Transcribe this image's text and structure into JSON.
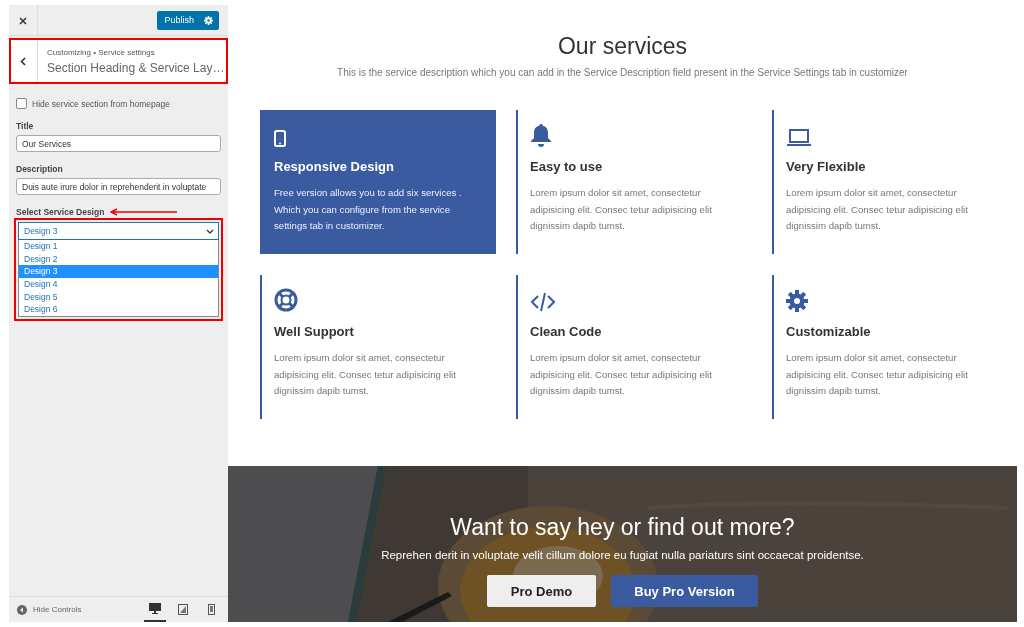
{
  "customizer": {
    "publish_button": "Publish",
    "breadcrumb": "Customizing • Service settings",
    "section_title": "Section Heading & Service Lay…",
    "hide_section": {
      "label": "Hide service section from homepage",
      "checked": false
    },
    "title_field": {
      "label": "Title",
      "value": "Our Services"
    },
    "description_field": {
      "label": "Description",
      "value": "Duis aute irure dolor in reprehenderit in voluptate"
    },
    "design_select": {
      "label": "Select Service Design",
      "value": "Design 3",
      "expanded": true,
      "options": [
        {
          "label": "Design 1",
          "selected": false
        },
        {
          "label": "Design 2",
          "selected": false
        },
        {
          "label": "Design 3",
          "selected": true
        },
        {
          "label": "Design 4",
          "selected": false
        },
        {
          "label": "Design 5",
          "selected": false
        },
        {
          "label": "Design 6",
          "selected": false
        }
      ]
    },
    "hide_controls": "Hide Controls",
    "devices": [
      {
        "kind": "desktop",
        "selected": true
      },
      {
        "kind": "tablet",
        "selected": false
      },
      {
        "kind": "mobile",
        "selected": false
      }
    ]
  },
  "services": {
    "heading": "Our services",
    "description": "This is the service description which you can add in the Service Description field present in the Service Settings tab in customizer",
    "items": [
      {
        "kind": "phone",
        "title": "Responsive Design",
        "text": "Free version allows you to add six services . Which you can configure from the service settings tab in customizer.",
        "highlighted": true
      },
      {
        "kind": "bell",
        "title": "Easy to use",
        "text": "Lorem ipsum dolor sit amet, consectetur adipisicing elit. Consec tetur adipisicing elit dignissim dapib tumst.",
        "highlighted": false
      },
      {
        "kind": "laptop",
        "title": "Very Flexible",
        "text": "Lorem ipsum dolor sit amet, consectetur adipisicing elit. Consec tetur adipisicing elit dignissim dapib tumst.",
        "highlighted": false
      },
      {
        "kind": "lifebuoy",
        "title": "Well Support",
        "text": "Lorem ipsum dolor sit amet, consectetur adipisicing elit. Consec tetur adipisicing elit dignissim dapib tumst.",
        "highlighted": false
      },
      {
        "kind": "code",
        "title": "Clean Code",
        "text": "Lorem ipsum dolor sit amet, consectetur adipisicing elit. Consec tetur adipisicing elit dignissim dapib tumst.",
        "highlighted": false
      },
      {
        "kind": "gear",
        "title": "Customizable",
        "text": "Lorem ipsum dolor sit amet, consectetur adipisicing elit. Consec tetur adipisicing elit dignissim dapib tumst.",
        "highlighted": false
      }
    ]
  },
  "banner": {
    "heading": "Want to say hey or find out more?",
    "text": "Reprehen derit in voluptate velit cillum dolore eu fugiat nulla pariaturs sint occaecat proidentse.",
    "buttons": [
      {
        "kind": "secondary",
        "label": "Pro Demo"
      },
      {
        "kind": "primary",
        "label": "Buy Pro Version"
      }
    ]
  }
}
